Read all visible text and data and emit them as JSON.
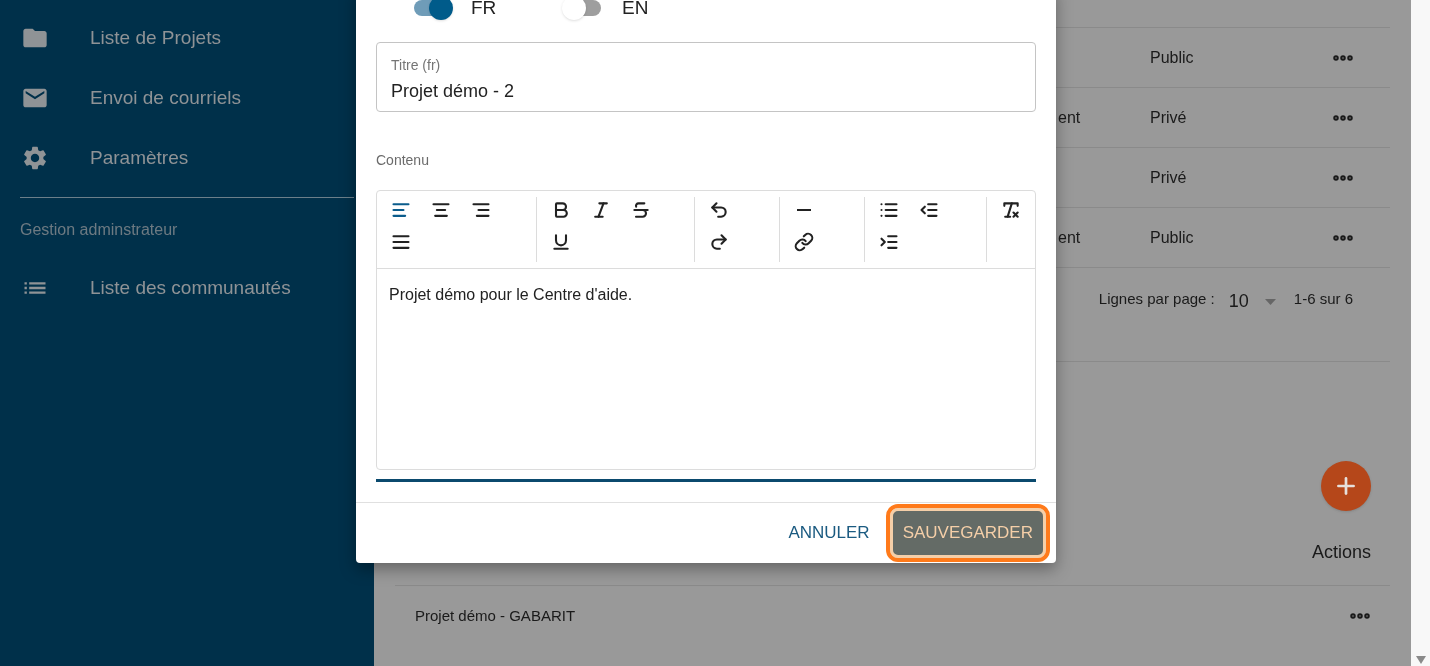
{
  "sidebar": {
    "items": [
      {
        "kind": "folder",
        "label": "Liste de Projets"
      },
      {
        "kind": "mail",
        "label": "Envoi de courriels"
      },
      {
        "kind": "settings",
        "label": "Paramètres"
      }
    ],
    "section_title": "Gestion adminstrateur",
    "admin_items": [
      {
        "kind": "list",
        "label": "Liste des communautés"
      }
    ]
  },
  "table": {
    "rows": [
      {
        "column_2": "",
        "visibility": "Public"
      },
      {
        "column_2": "ent",
        "visibility": "Privé"
      },
      {
        "column_2": "",
        "visibility": "Privé"
      },
      {
        "column_2": "ent",
        "visibility": "Public"
      }
    ],
    "pagination": {
      "rows_label": "Lignes par page :",
      "rows_value": "10",
      "range": "1-6 sur 6"
    }
  },
  "second_table": {
    "actions_header": "Actions",
    "rows": [
      {
        "name": "Projet démo - GABARIT"
      }
    ]
  },
  "dialog": {
    "languages": [
      {
        "label": "FR",
        "on": true
      },
      {
        "label": "EN",
        "on": false
      }
    ],
    "title_field": {
      "label": "Titre (fr)",
      "value": "Projet démo - 2"
    },
    "content_label": "Contenu",
    "toolbar": [
      [
        {
          "kind": "align-left",
          "selected": true
        },
        {
          "kind": "align-center",
          "selected": false
        },
        {
          "kind": "align-right",
          "selected": false
        },
        {
          "kind": "justify",
          "selected": false
        }
      ],
      [
        {
          "kind": "bold",
          "selected": false
        },
        {
          "kind": "italic",
          "selected": false
        },
        {
          "kind": "strike",
          "selected": false
        },
        {
          "kind": "underline",
          "selected": false
        }
      ],
      [
        {
          "kind": "undo",
          "selected": false
        },
        {
          "kind": "redo",
          "selected": false
        }
      ],
      [
        {
          "kind": "rule",
          "selected": false
        },
        {
          "kind": "link",
          "selected": false
        }
      ],
      [
        {
          "kind": "bullets",
          "selected": false
        },
        {
          "kind": "outdent",
          "selected": false
        },
        {
          "kind": "indent",
          "selected": false
        }
      ],
      [
        {
          "kind": "clear",
          "selected": false
        }
      ]
    ],
    "content": "Projet démo pour le Centre d'aide.",
    "buttons": [
      {
        "kind": "text",
        "label": "ANNULER"
      },
      {
        "kind": "primary",
        "label": "SAUVEGARDER"
      }
    ]
  }
}
